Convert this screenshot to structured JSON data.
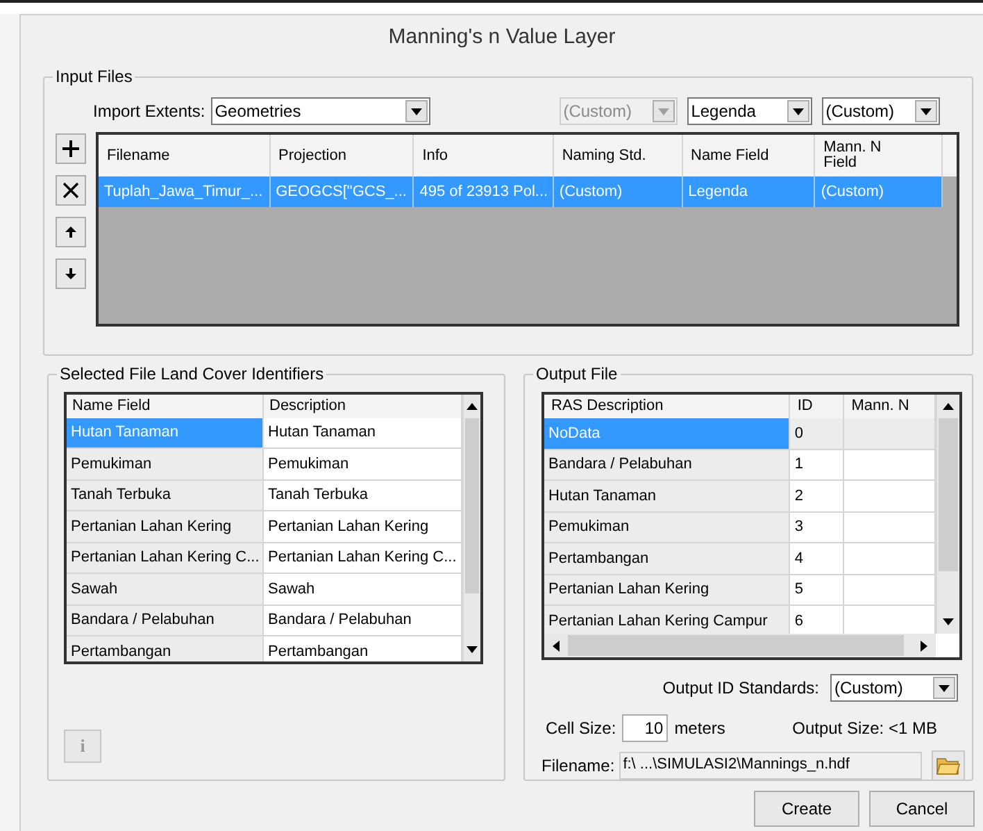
{
  "window": {
    "title": "Manning's n Value Layer"
  },
  "input_files": {
    "title": "Input Files",
    "import_extents_label": "Import Extents:",
    "import_extents": "Geometries",
    "dropdowns": [
      {
        "value": "(Custom)",
        "disabled": true
      },
      {
        "value": "Legenda",
        "disabled": false
      },
      {
        "value": "(Custom)",
        "disabled": false
      }
    ],
    "side_buttons": [
      {
        "kind": "add"
      },
      {
        "kind": "remove"
      },
      {
        "kind": "up"
      },
      {
        "kind": "down"
      }
    ],
    "columns": [
      "Filename",
      "Projection",
      "Info",
      "Naming Std.",
      "Name Field",
      "Mann. N Field"
    ],
    "rows": [
      {
        "selected": true,
        "cells": [
          "Tuplah_Jawa_Timur_...",
          "GEOGCS[\"GCS_...",
          "495 of 23913 Pol...",
          "(Custom)",
          "Legenda",
          "(Custom)"
        ]
      }
    ]
  },
  "land_cover": {
    "title": "Selected File Land Cover Identifiers",
    "columns": [
      "Name Field",
      "Description"
    ],
    "rows": [
      {
        "selected": true,
        "cells": [
          "Hutan Tanaman",
          "Hutan Tanaman"
        ]
      },
      {
        "selected": false,
        "cells": [
          "Pemukiman",
          "Pemukiman"
        ]
      },
      {
        "selected": false,
        "cells": [
          "Tanah Terbuka",
          "Tanah Terbuka"
        ]
      },
      {
        "selected": false,
        "cells": [
          "Pertanian Lahan Kering",
          "Pertanian Lahan Kering"
        ]
      },
      {
        "selected": false,
        "cells": [
          "Pertanian Lahan Kering C...",
          "Pertanian Lahan Kering C..."
        ]
      },
      {
        "selected": false,
        "cells": [
          "Sawah",
          "Sawah"
        ]
      },
      {
        "selected": false,
        "cells": [
          "Bandara / Pelabuhan",
          "Bandara / Pelabuhan"
        ]
      },
      {
        "selected": false,
        "cells": [
          "Pertambangan",
          "Pertambangan"
        ]
      }
    ],
    "info_button": "i"
  },
  "output_file": {
    "title": "Output File",
    "columns": [
      "RAS Description",
      "ID",
      "Mann. N"
    ],
    "rows": [
      {
        "selected": true,
        "cells": [
          "NoData",
          "0"
        ]
      },
      {
        "selected": false,
        "cells": [
          "Bandara / Pelabuhan",
          "1"
        ]
      },
      {
        "selected": false,
        "cells": [
          "Hutan Tanaman",
          "2"
        ]
      },
      {
        "selected": false,
        "cells": [
          "Pemukiman",
          "3"
        ]
      },
      {
        "selected": false,
        "cells": [
          "Pertambangan",
          "4"
        ]
      },
      {
        "selected": false,
        "cells": [
          "Pertanian Lahan Kering",
          "5"
        ]
      },
      {
        "selected": false,
        "cells": [
          "Pertanian Lahan Kering Campur",
          "6"
        ]
      }
    ],
    "standards_label": "Output ID Standards:",
    "standards": "(Custom)",
    "cell_size_label": "Cell Size:",
    "cell_size": "10",
    "cell_size_unit": "meters",
    "output_size": "Output Size: <1 MB",
    "filename_label": "Filename:",
    "filename": "f:\\ ...\\SIMULASI2\\Mannings_n.hdf"
  },
  "buttons": [
    "Create",
    "Cancel"
  ]
}
